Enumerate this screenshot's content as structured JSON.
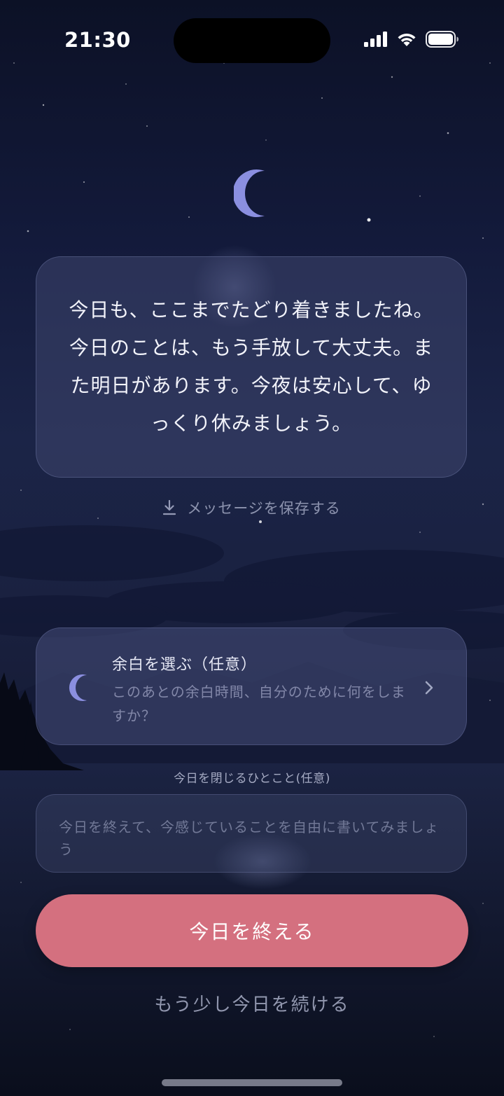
{
  "status_bar": {
    "time": "21:30",
    "icons": [
      "cellular-signal-icon",
      "wifi-icon",
      "battery-icon"
    ]
  },
  "header": {
    "icon": "crescent-moon-icon",
    "icon_color": "#8b8fe0"
  },
  "message": {
    "text": "今日も、ここまでたどり着きましたね。今日のことは、もう手放して大丈夫。また明日があります。今夜は安心して、ゆっくり休みましょう。"
  },
  "save_action": {
    "icon": "download-icon",
    "label": "メッセージを保存する"
  },
  "choose_card": {
    "icon": "crescent-moon-icon",
    "title": "余白を選ぶ（任意）",
    "description": "このあとの余白時間、自分のために何をしますか？",
    "chevron": "chevron-right-icon"
  },
  "closing_note": {
    "label": "今日を閉じるひとこと(任意)",
    "placeholder": "今日を終えて、今感じていることを自由に書いてみましょう"
  },
  "actions": {
    "primary_label": "今日を終える",
    "primary_color": "#d4707f",
    "secondary_label": "もう少し今日を続ける"
  }
}
